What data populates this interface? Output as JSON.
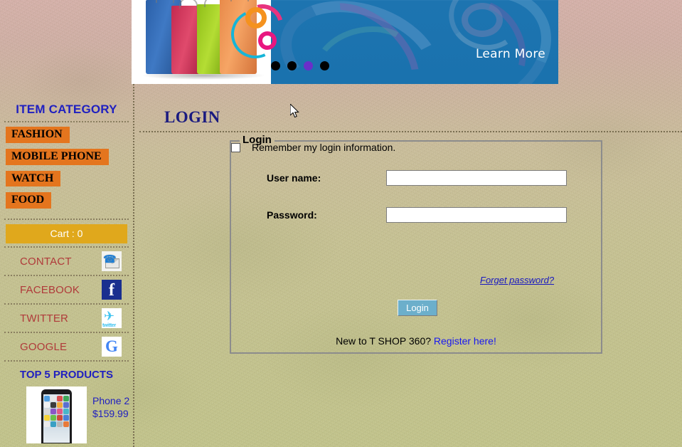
{
  "banner": {
    "learn_more": "Learn More",
    "dots": [
      {
        "name": "slide-1",
        "active": false
      },
      {
        "name": "slide-2",
        "active": false
      },
      {
        "name": "slide-3",
        "active": true
      },
      {
        "name": "slide-4",
        "active": false
      }
    ],
    "bag_colors": [
      "#2a5fa8",
      "#c32a50",
      "#8fbe18",
      "#e88a4a"
    ],
    "blue": "#1a72ae"
  },
  "sidebar": {
    "category_title": "ITEM CATEGORY",
    "categories": [
      {
        "label": "FASHION"
      },
      {
        "label": "MOBILE PHONE"
      },
      {
        "label": "WATCH"
      },
      {
        "label": "FOOD"
      }
    ],
    "category_color": "#e4751e",
    "cart": {
      "label": "Cart : 0",
      "color": "#e0a81c"
    },
    "social": [
      {
        "label": "CONTACT",
        "icon": "phone-envelope-icon"
      },
      {
        "label": "FACEBOOK",
        "icon": "facebook-icon"
      },
      {
        "label": "TWITTER",
        "icon": "twitter-icon"
      },
      {
        "label": "GOOGLE",
        "icon": "google-icon"
      }
    ],
    "social_label_color": "#b03a3a",
    "top_products": {
      "title": "TOP 5 PRODUCTS",
      "items": [
        {
          "name": "Phone 2",
          "price": "$159.99",
          "image": "phone-thumbnail"
        }
      ]
    },
    "heading_color": "#2020c0"
  },
  "main": {
    "page_title": "LOGIN",
    "page_title_color": "#1a1a80",
    "form": {
      "legend": "Login",
      "username_label": "User name:",
      "username_value": "",
      "username_placeholder": "",
      "password_label": "Password:",
      "password_value": "",
      "password_placeholder": "",
      "remember_label": "Remember my login information.",
      "remember_checked": false,
      "forget_password_link": "Forget password?",
      "login_button": "Login",
      "login_button_color": "#6cafcb",
      "register_prompt": "New to T SHOP 360?",
      "register_link": "Register here!",
      "register_link_color": "#1818f0"
    }
  },
  "icons": {
    "facebook_glyph": "f",
    "twitter_glyph": "✈",
    "twitter_word": "twitter",
    "google_glyph": "G",
    "phone_glyph": "☎",
    "cursor": "arrow-pointer"
  }
}
